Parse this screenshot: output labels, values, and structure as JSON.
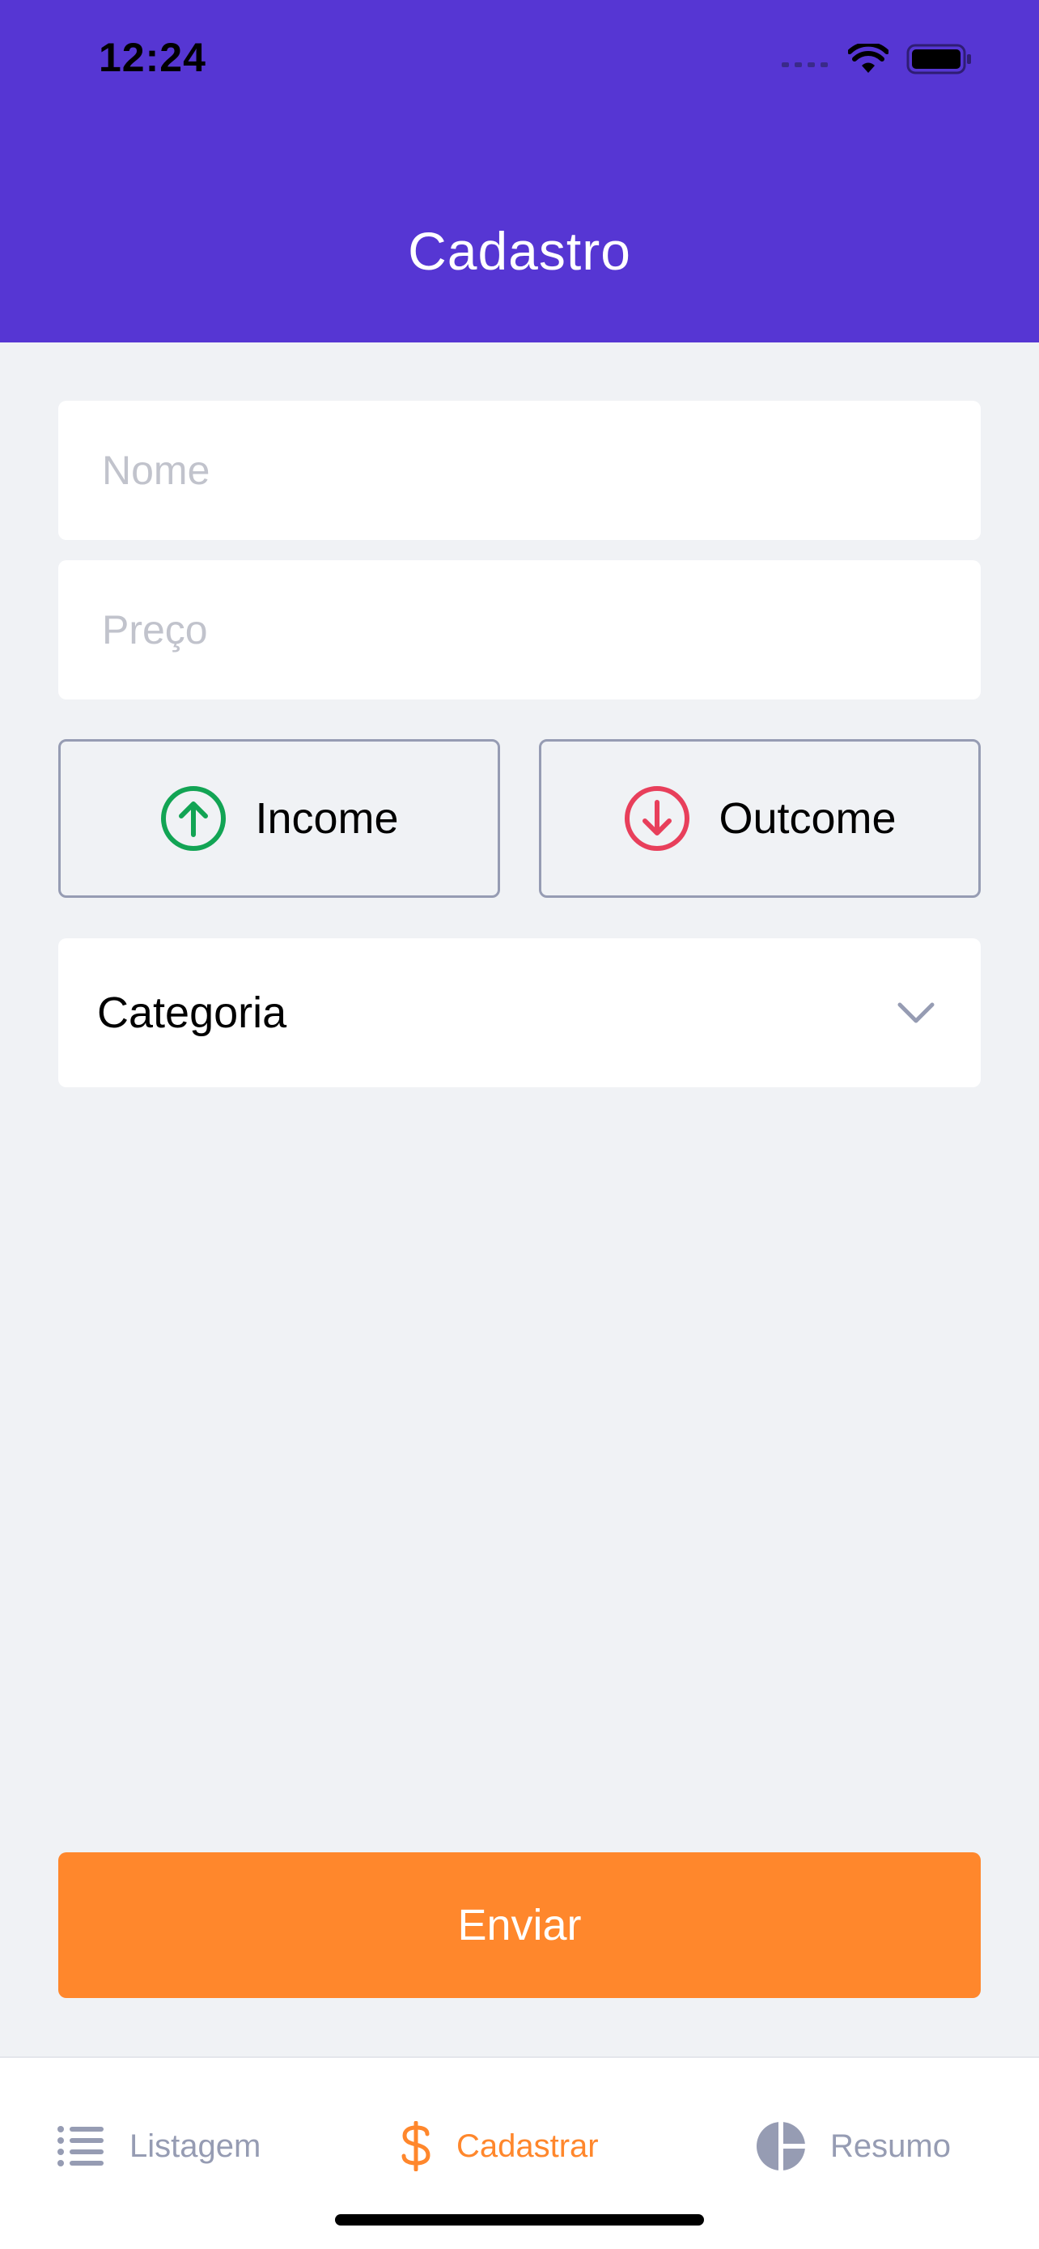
{
  "status_bar": {
    "time": "12:24",
    "icons": [
      "signal-icon",
      "wifi-icon",
      "battery-icon"
    ]
  },
  "header": {
    "title": "Cadastro",
    "background": "#5636d3"
  },
  "form": {
    "name_placeholder": "Nome",
    "name_value": "",
    "price_placeholder": "Preço",
    "price_value": "",
    "income_label": "Income",
    "outcome_label": "Outcome",
    "category_label": "Categoria",
    "submit_label": "Enviar"
  },
  "colors": {
    "income": "#12a454",
    "outcome": "#e83f5b",
    "accent": "#ff872c",
    "muted": "#969cb3"
  },
  "tabs": [
    {
      "label": "Listagem",
      "icon": "list-icon",
      "active": false
    },
    {
      "label": "Cadastrar",
      "icon": "dollar-sign-icon",
      "active": true
    },
    {
      "label": "Resumo",
      "icon": "pie-chart-icon",
      "active": false
    }
  ]
}
